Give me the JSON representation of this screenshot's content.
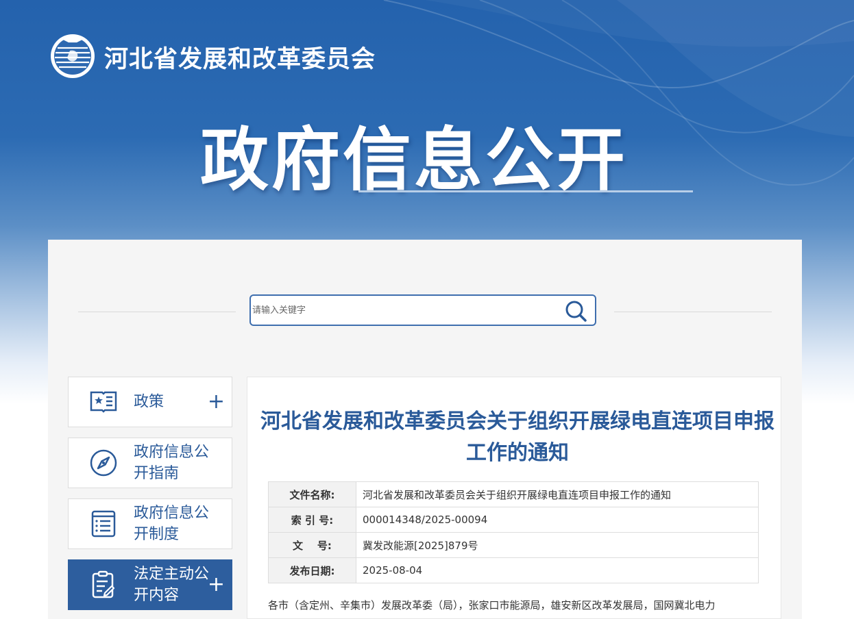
{
  "header": {
    "org_name": "河北省发展和改革委员会",
    "hero_title": "政府信息公开"
  },
  "search": {
    "placeholder": "请输入关键字",
    "icon": "search-icon"
  },
  "sidebar": {
    "items": [
      {
        "label": "政策",
        "icon": "policy-book-icon",
        "expandable": true,
        "active": false
      },
      {
        "label": "政府信息公开指南",
        "icon": "compass-icon",
        "expandable": false,
        "active": false
      },
      {
        "label": "政府信息公开制度",
        "icon": "document-list-icon",
        "expandable": false,
        "active": false
      },
      {
        "label": "法定主动公开内容",
        "icon": "edit-document-icon",
        "expandable": true,
        "active": true
      }
    ]
  },
  "article": {
    "title": "河北省发展和改革委员会关于组织开展绿电直连项目申报工作的通知",
    "meta": [
      {
        "key": "文件名称:",
        "value": "河北省发展和改革委员会关于组织开展绿电直连项目申报工作的通知"
      },
      {
        "key": "索 引 号:",
        "value": "000014348/2025-00094"
      },
      {
        "key": "文    号:",
        "value": "冀发改能源[2025]879号"
      },
      {
        "key": "发布日期:",
        "value": "2025-08-04"
      }
    ],
    "body_first_line": "各市（含定州、辛集市）发展改革委（局），张家口市能源局，雄安新区改革发展局，国网冀北电力"
  },
  "colors": {
    "brand_blue": "#2462ad",
    "title_blue": "#2a5a99",
    "active_nav": "#2d5e9e"
  }
}
